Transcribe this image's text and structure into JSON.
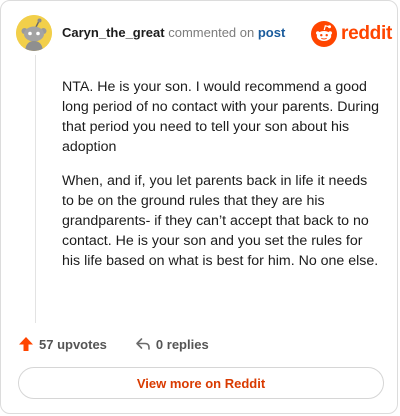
{
  "comment_header": {
    "username": "Caryn_the_great",
    "action_text": "commented on",
    "post_link": "post"
  },
  "brand": {
    "icon": "reddit-alien-icon",
    "wordmark": "reddit",
    "color": "#ff4500"
  },
  "comment_body": {
    "paragraphs": [
      "NTA. He is your son. I would recommend a good long period of no contact with your parents. During that period you need to tell your son about his adoption",
      "When, and if, you let parents back in life it needs to be on the ground rules that they are his grandparents- if they can’t accept that back to no contact. He is your son and you set the rules for his life based on what is best for him. No one else."
    ]
  },
  "actions": {
    "upvotes": "57 upvotes",
    "replies": "0 replies",
    "upvote_icon": "upvote-arrow-icon",
    "reply_icon": "reply-icon"
  },
  "footer": {
    "view_more_label": "View more on Reddit"
  },
  "colors": {
    "accent": "#ff4500",
    "link": "#1a5b9c",
    "avatar_bg": "#f2cf4a",
    "view_more_text": "#d93a00"
  }
}
